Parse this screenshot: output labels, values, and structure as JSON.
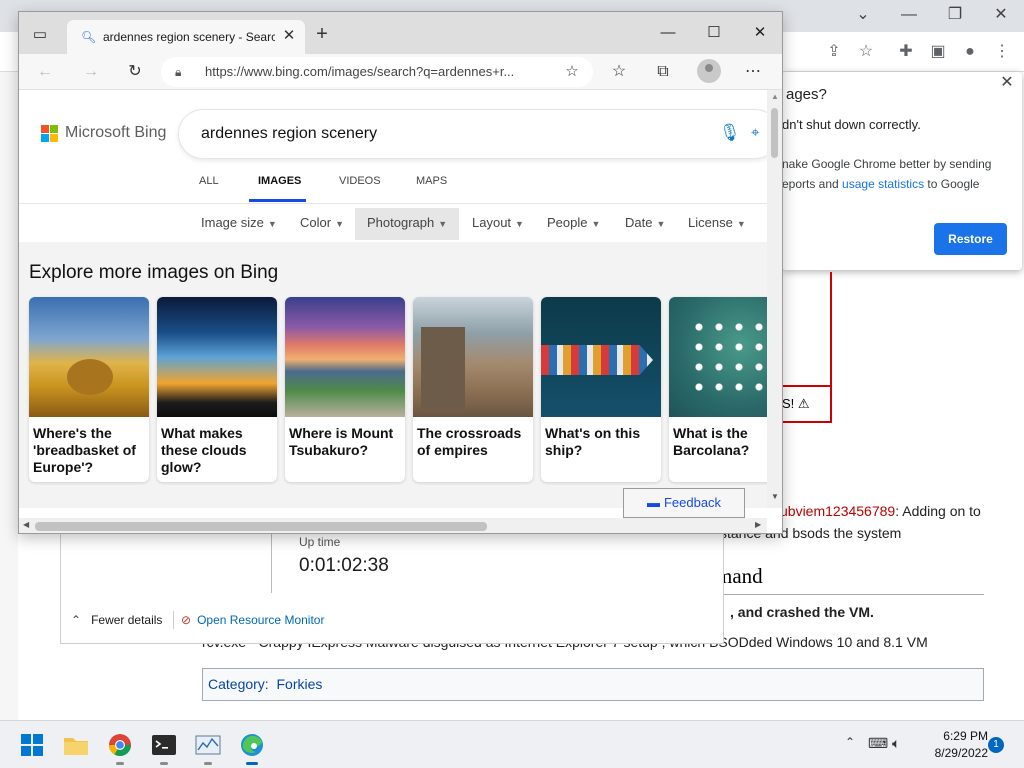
{
  "chrome_popup": {
    "title_fragment": "ages?",
    "line1": "dn't shut down correctly.",
    "line2": "nake Google Chrome better by sending",
    "line3_prefix": "eports and ",
    "line3_link": "usage statistics",
    "line3_suffix": " to Google",
    "restore_label": "Restore"
  },
  "wiki": {
    "redbox_text": "S! ⚠",
    "side_paren": ")",
    "reply_user": "ubviem123456789",
    "reply_text": ": Adding on to",
    "reply_line2": "stance and bsods the system",
    "heading_fragment": "mand",
    "bold_line": ", and crashed the VM.",
    "desc_line": "rcv.exe - Crappy IExpress Malware disguised as Internet Explorer 7 setup , which BSODded Windows 10 and 8.1 VM",
    "category_label": "Category:",
    "category_value": "Forkies"
  },
  "taskmgr": {
    "uptime_label": "Up time",
    "uptime_value": "0:01:02:38",
    "fewer_details": "Fewer details",
    "open_monitor": "Open Resource Monitor"
  },
  "edge": {
    "tab_title": "ardennes region scenery - Search",
    "url": "https://www.bing.com/images/search?q=ardennes+r...",
    "bing": {
      "logo_text": "Microsoft Bing",
      "query": "ardennes region scenery",
      "tabs": [
        "ALL",
        "IMAGES",
        "VIDEOS",
        "MAPS"
      ],
      "active_tab": "IMAGES",
      "filters": [
        "Image size",
        "Color",
        "Photograph",
        "Layout",
        "People",
        "Date",
        "License"
      ],
      "active_filter": "Photograph",
      "explore_title": "Explore more images on Bing",
      "cards": [
        {
          "caption": "Where's the 'breadbasket of Europe'?"
        },
        {
          "caption": "What makes these clouds glow?"
        },
        {
          "caption": "Where is Mount Tsubakuro?"
        },
        {
          "caption": "The crossroads of empires"
        },
        {
          "caption": "What's on this ship?"
        },
        {
          "caption": "What is the Barcolana?"
        }
      ],
      "feedback_label": "Feedback"
    }
  },
  "taskbar": {
    "time": "6:29 PM",
    "date": "8/29/2022",
    "notification_count": "1"
  },
  "colors": {
    "bing_blue": "#174ae4",
    "chrome_blue": "#1a73e8",
    "wiki_red": "#cc0000"
  }
}
